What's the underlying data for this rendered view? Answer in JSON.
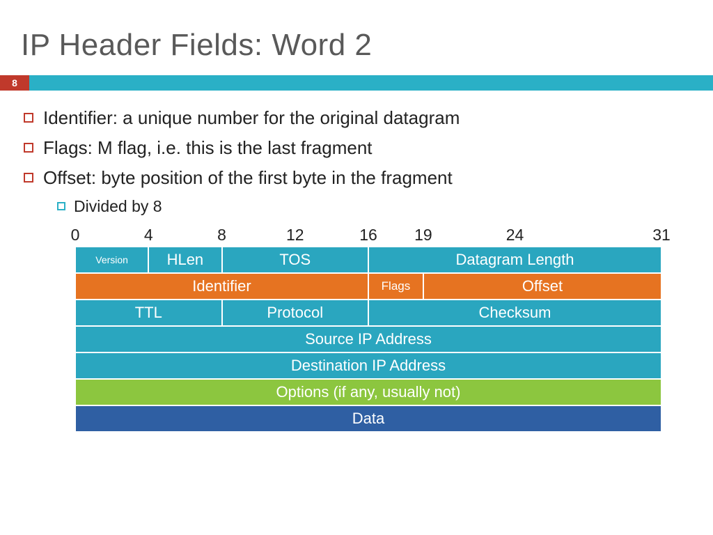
{
  "title": "IP Header Fields: Word 2",
  "page_number": "8",
  "bullets": [
    "Identifier: a unique number for the original datagram",
    "Flags: M flag, i.e. this is the last fragment",
    "Offset: byte position of the first byte in the fragment"
  ],
  "sub_bullet": "Divided by 8",
  "bit_scale": [
    "0",
    "4",
    "8",
    "12",
    "16",
    "19",
    "24",
    "31"
  ],
  "bit_scale_positions": [
    0,
    12.5,
    25,
    37.5,
    50,
    59.375,
    75,
    100
  ],
  "diagram": {
    "row1": [
      {
        "label": "Version",
        "bits": 4,
        "color": "teal",
        "size": "small"
      },
      {
        "label": "HLen",
        "bits": 4,
        "color": "teal"
      },
      {
        "label": "TOS",
        "bits": 8,
        "color": "teal"
      },
      {
        "label": "Datagram Length",
        "bits": 16,
        "color": "teal"
      }
    ],
    "row2": [
      {
        "label": "Identifier",
        "bits": 16,
        "color": "orange"
      },
      {
        "label": "Flags",
        "bits": 3,
        "color": "orange",
        "size": "med"
      },
      {
        "label": "Offset",
        "bits": 13,
        "color": "orange"
      }
    ],
    "row3": [
      {
        "label": "TTL",
        "bits": 8,
        "color": "teal"
      },
      {
        "label": "Protocol",
        "bits": 8,
        "color": "teal"
      },
      {
        "label": "Checksum",
        "bits": 16,
        "color": "teal"
      }
    ],
    "row4": [
      {
        "label": "Source IP Address",
        "bits": 32,
        "color": "teal"
      }
    ],
    "row5": [
      {
        "label": "Destination IP Address",
        "bits": 32,
        "color": "teal"
      }
    ],
    "row6": [
      {
        "label": "Options (if any, usually not)",
        "bits": 32,
        "color": "green"
      }
    ],
    "row7": [
      {
        "label": "Data",
        "bits": 32,
        "color": "blue"
      }
    ]
  }
}
